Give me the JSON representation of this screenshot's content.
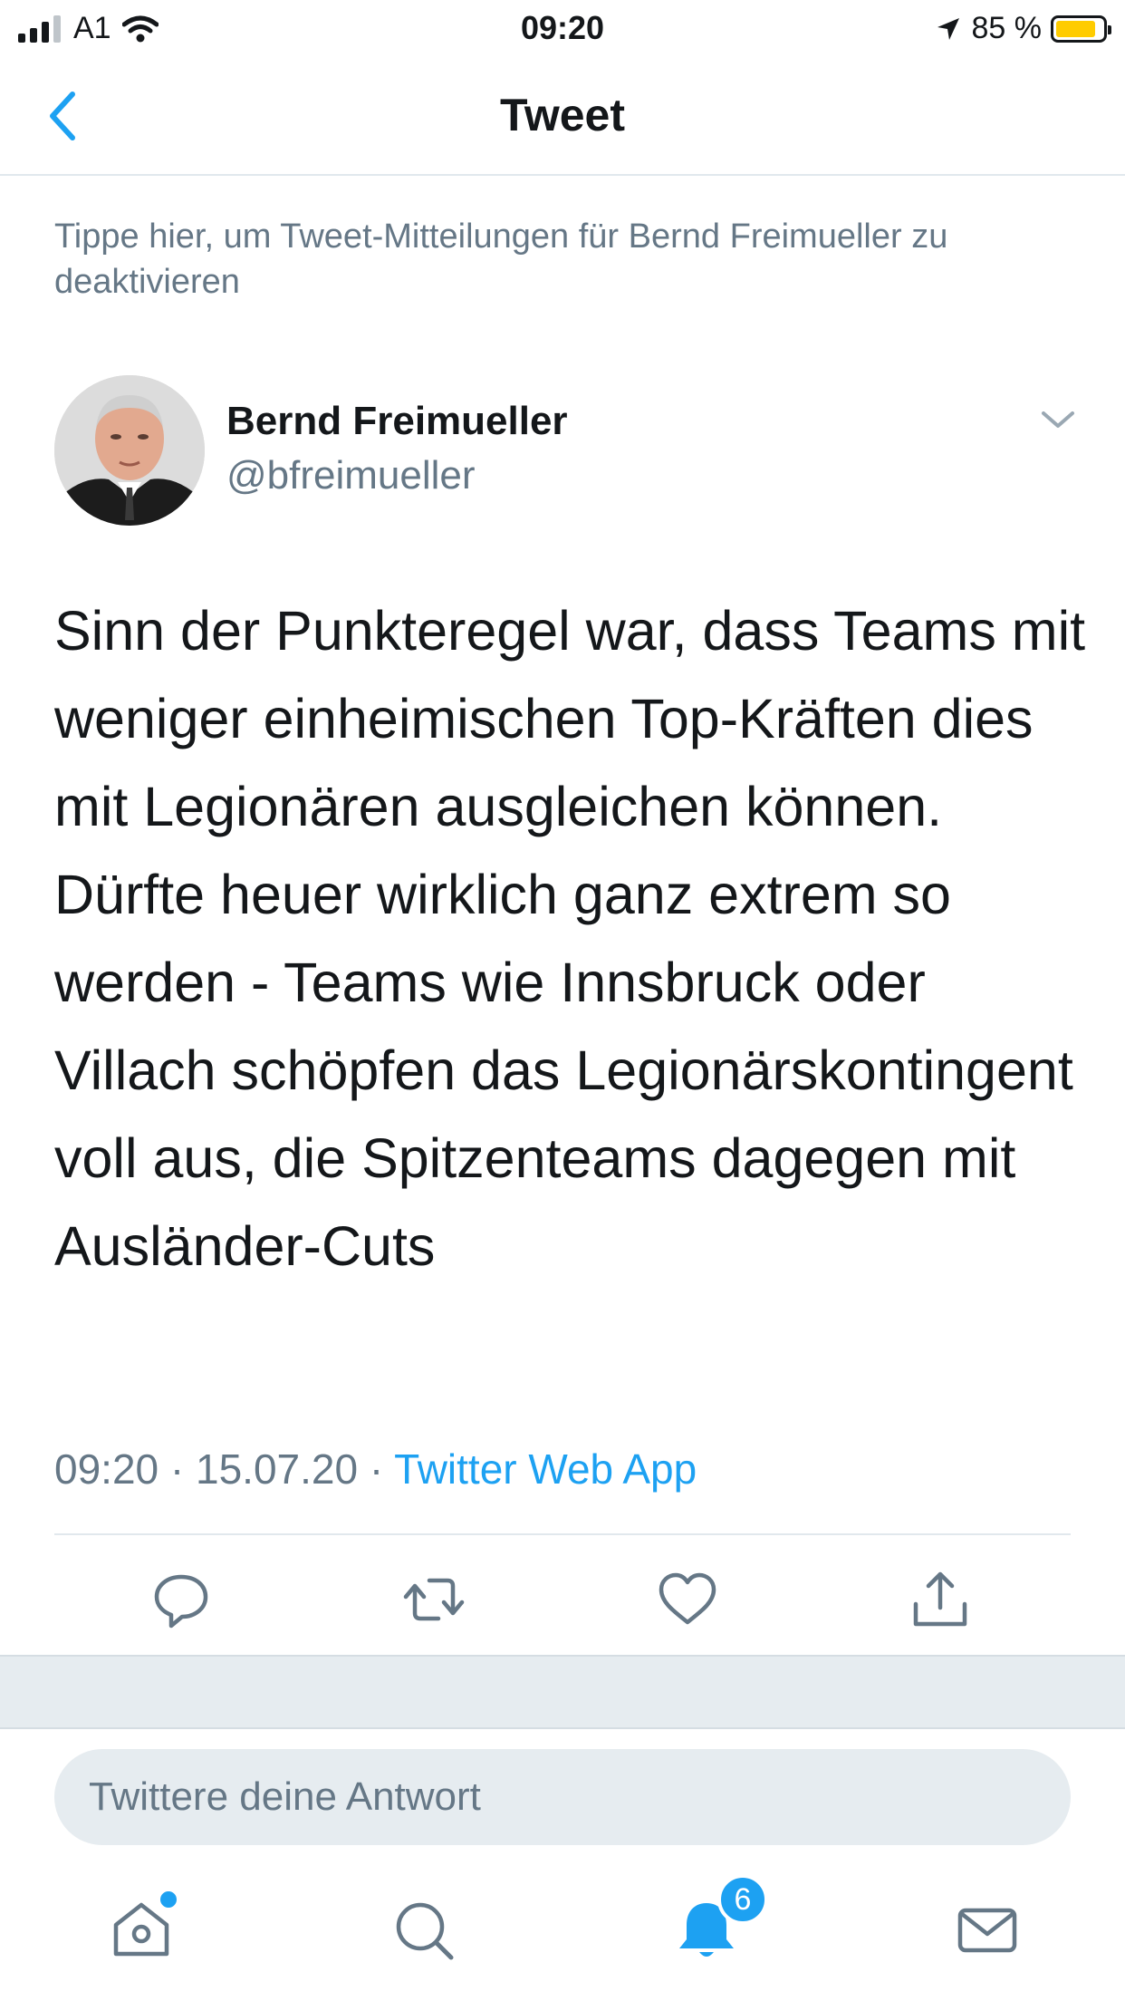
{
  "status_bar": {
    "carrier": "A1",
    "time": "09:20",
    "battery_percent": "85 %",
    "battery_level": 0.85,
    "icons": [
      "cellular-signal-icon",
      "wifi-icon",
      "location-arrow-icon",
      "battery-icon"
    ]
  },
  "nav": {
    "title": "Tweet",
    "back_icon": "chevron-left-icon"
  },
  "notify_banner": "Tippe hier, um Tweet-Mitteilungen für Bernd Freimueller zu deaktivieren",
  "tweet": {
    "author_name": "Bernd Freimueller",
    "author_handle": "@bfreimueller",
    "text": "Sinn der Punkteregel war, dass Teams mit weniger einheimischen Top-Kräften dies mit Legionären ausgleichen können. Dürfte heuer wirklich ganz extrem so werden - Teams wie Innsbruck oder Villach schöpfen das Legionärskontingent voll aus, die Spitzenteams dagegen mit Ausländer-Cuts",
    "time": "09:20",
    "separator": "·",
    "date": "15.07.20",
    "source": "Twitter Web App"
  },
  "actions": [
    "reply-icon",
    "retweet-icon",
    "like-icon",
    "share-icon"
  ],
  "reply": {
    "placeholder": "Twittere deine Antwort"
  },
  "tab_bar": {
    "tabs": [
      "home-icon",
      "search-icon",
      "notifications-icon",
      "messages-icon"
    ],
    "notifications_count": "6"
  },
  "colors": {
    "accent": "#1da1f2",
    "secondary_text": "#657786",
    "battery": "#ffcc00"
  }
}
